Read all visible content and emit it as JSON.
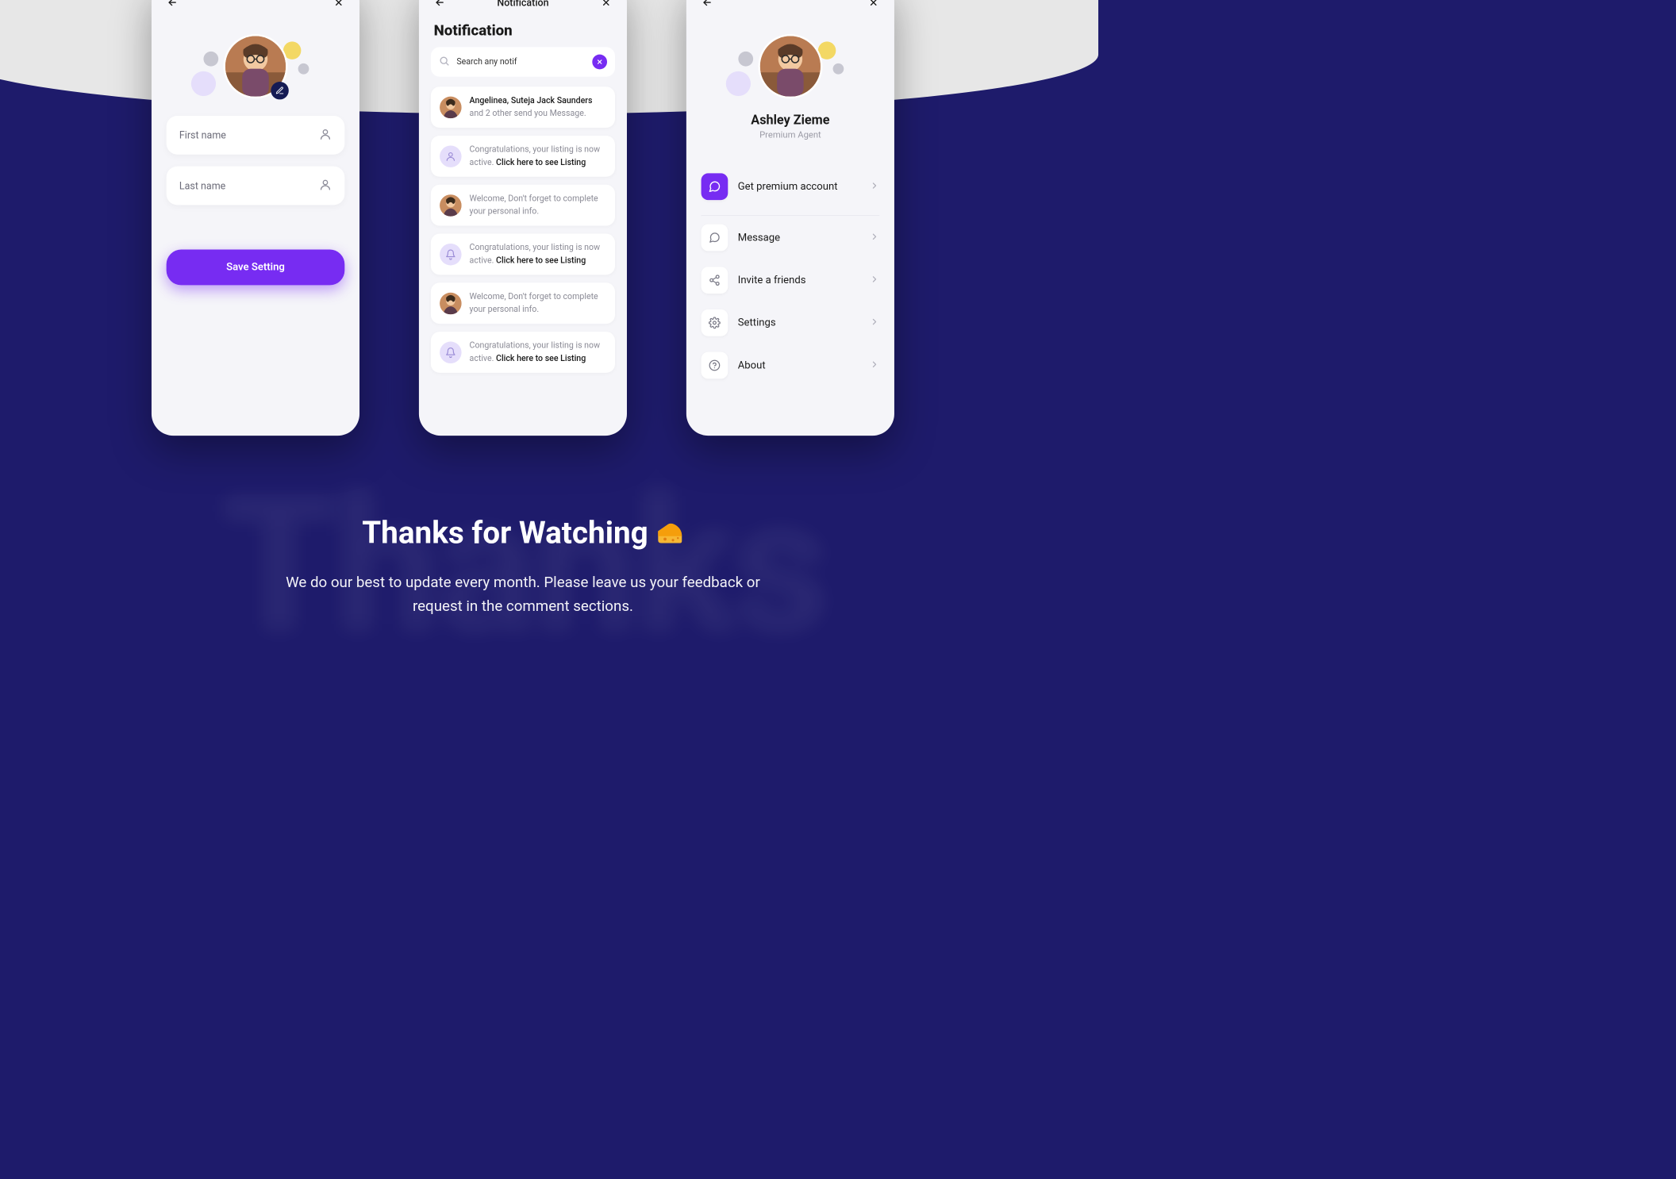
{
  "thanks": {
    "bg_word": "Thanks",
    "title": "Thanks for Watching",
    "subtitle": "We do our best to update every month. Please leave us your feedback or request in the comment sections."
  },
  "screen1": {
    "first_name_ph": "First name",
    "last_name_ph": "Last name",
    "save_label": "Save Setting"
  },
  "screen2": {
    "header": "Notification",
    "title": "Notification",
    "search_value": "Search any notif",
    "items": [
      {
        "kind": "avatar",
        "line1": "Angelinea, Suteja Jack Saunders",
        "line2": "and 2 other send you Message."
      },
      {
        "kind": "user-icon",
        "muted": "Congratulations, your listing is now active. ",
        "link": "Click here to see Listing"
      },
      {
        "kind": "avatar",
        "muted": "Welcome, Don't forget to complete your personal info.",
        "link": ""
      },
      {
        "kind": "bell-icon",
        "muted": "Congratulations, your listing is now active. ",
        "link": "Click here to see Listing"
      },
      {
        "kind": "avatar",
        "muted": "Welcome, Don't forget to complete your personal info.",
        "link": ""
      },
      {
        "kind": "bell-icon",
        "muted": "Congratulations, your listing is now active. ",
        "link": "Click here to see Listing"
      }
    ]
  },
  "screen3": {
    "name": "Ashley Zieme",
    "role": "Premium Agent",
    "menu": [
      {
        "icon": "chat-solid",
        "label": "Get premium account",
        "primary": true
      },
      {
        "icon": "chat",
        "label": "Message"
      },
      {
        "icon": "share",
        "label": "Invite a friends"
      },
      {
        "icon": "gear",
        "label": "Settings"
      },
      {
        "icon": "help",
        "label": "About"
      }
    ]
  }
}
